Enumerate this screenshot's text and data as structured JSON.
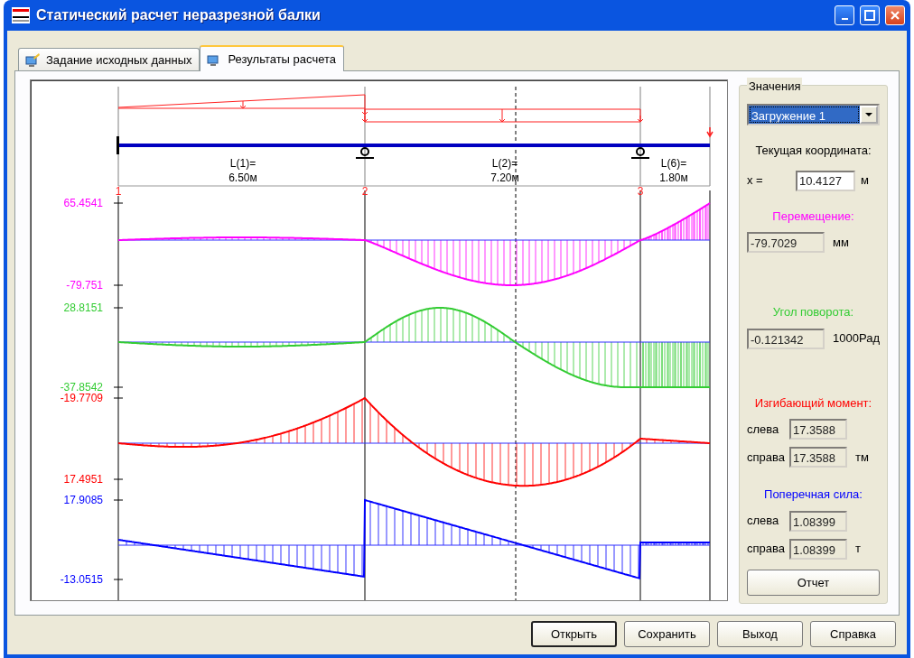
{
  "window": {
    "title": "Статический расчет неразрезной балки"
  },
  "tabs": [
    {
      "label": "Задание исходных данных",
      "selected": false
    },
    {
      "label": "Результаты расчета",
      "selected": true
    }
  ],
  "beam": {
    "nodes": [
      "1",
      "2",
      "3"
    ],
    "spans": [
      {
        "name": "L(1)=",
        "length": "6.50м"
      },
      {
        "name": "L(2)=",
        "length": "7.20м"
      },
      {
        "name": "L(6)=",
        "length": "1.80м"
      }
    ]
  },
  "diagrams": [
    {
      "kind": "displacement",
      "color": "#ff00ff",
      "max_label": "65.4541",
      "min_label": "-79.751"
    },
    {
      "kind": "rotation",
      "color": "#33cc33",
      "max_label": "28.8151",
      "min_label": "-37.8542"
    },
    {
      "kind": "moment",
      "color": "#ff0000",
      "max_label": "-19.7709",
      "min_label": "17.4951"
    },
    {
      "kind": "shear",
      "color": "#0000ff",
      "max_label": "17.9085",
      "min_label": "-13.0515"
    }
  ],
  "panel": {
    "title": "Значения",
    "load_case": "Загружение 1",
    "coordinate_title": "Текущая координата:",
    "x_label": "x =",
    "x_value": "10.4127",
    "x_unit": "м",
    "results": [
      {
        "title": "Перемещение:",
        "color": "#ff00ff",
        "fields": [
          {
            "value": "-79.7029",
            "unit": "мм"
          }
        ]
      },
      {
        "title": "Угол  поворота:",
        "color": "#33cc33",
        "fields": [
          {
            "value": "-0.121342",
            "unit": "1000Рад"
          }
        ]
      },
      {
        "title": "Изгибающий момент:",
        "color": "#ff0000",
        "fields": [
          {
            "label": "слева",
            "value": "17.3588"
          },
          {
            "label": "справа",
            "value": "17.3588",
            "unit": "тм"
          }
        ]
      },
      {
        "title": "Поперечная  сила:",
        "color": "#0000ff",
        "fields": [
          {
            "label": "слева",
            "value": "1.08399"
          },
          {
            "label": "справа",
            "value": "1.08399",
            "unit": "т"
          }
        ]
      }
    ],
    "report_button": "Отчет"
  },
  "buttons": [
    {
      "label": "Открыть",
      "default": true
    },
    {
      "label": "Сохранить",
      "default": false
    },
    {
      "label": "Выход",
      "default": false
    },
    {
      "label": "Справка",
      "default": false
    }
  ]
}
